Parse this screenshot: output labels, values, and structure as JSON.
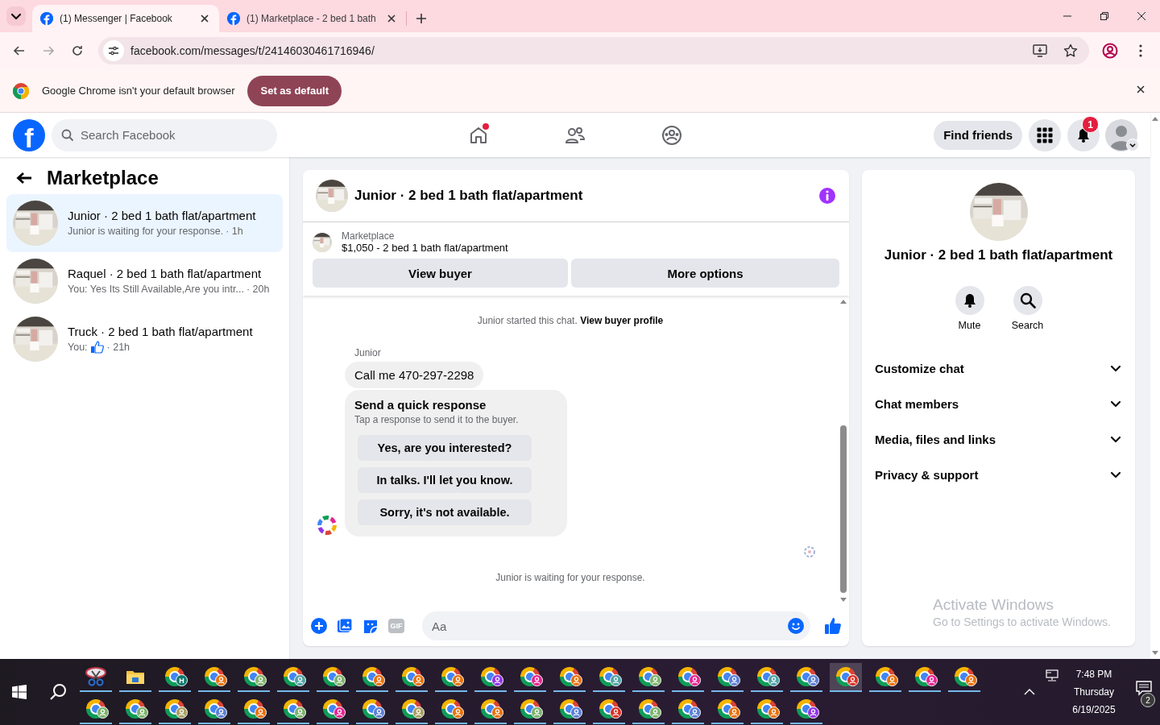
{
  "browser": {
    "tabs": [
      {
        "title": "(1) Messenger | Facebook",
        "selected": true
      },
      {
        "title": "(1) Marketplace - 2 bed 1 bath",
        "selected": false
      }
    ],
    "url": "facebook.com/messages/t/24146030461716946/"
  },
  "infobar": {
    "message": "Google Chrome isn't your default browser",
    "button": "Set as default"
  },
  "header": {
    "logo": "f",
    "search_placeholder": "Search Facebook",
    "nav": [
      {
        "kind": "home",
        "dot": true
      },
      {
        "kind": "friends",
        "dot": false
      },
      {
        "kind": "groups",
        "dot": false
      }
    ],
    "find_friends": "Find friends",
    "notification_count": "1"
  },
  "sidebar": {
    "title": "Marketplace",
    "conversations": [
      {
        "title": "Junior · 2 bed 1 bath flat/apartment",
        "kind": "text",
        "preview": "Junior is waiting for your response.",
        "time": "· 1h",
        "selected": true
      },
      {
        "title": "Raquel · 2 bed 1 bath flat/apartment",
        "kind": "text",
        "preview": "You: Yes Its Still Available,Are you intr...",
        "time": "· 20h",
        "selected": false
      },
      {
        "title": "Truck · 2 bed 1 bath flat/apartment",
        "kind": "like",
        "preview": "You:",
        "time": "· 21h",
        "selected": false
      }
    ]
  },
  "chat": {
    "title": "Junior · 2 bed 1 bath flat/apartment",
    "listing": {
      "label": "Marketplace",
      "detail": "$1,050 - 2 bed 1 bath flat/apartment"
    },
    "actions": [
      "View buyer",
      "More options"
    ],
    "system_note": {
      "text": "Junior started this chat.",
      "link": "View buyer profile"
    },
    "sender": "Junior",
    "message": "Call me 470-297-2298",
    "quick_response": {
      "title": "Send a quick response",
      "subtitle": "Tap a response to send it to the buyer.",
      "options": [
        "Yes, are you interested?",
        "In talks. I'll let you know.",
        "Sorry, it's not available."
      ]
    },
    "status": "Junior is waiting for your response.",
    "composer": {
      "gif": "GIF",
      "placeholder": "Aa"
    }
  },
  "details": {
    "title": "Junior · 2 bed 1 bath flat/apartment",
    "actions": [
      {
        "kind": "mute",
        "label": "Mute"
      },
      {
        "kind": "search",
        "label": "Search"
      }
    ],
    "sections": [
      {
        "label": "Customize chat",
        "expanded": false
      },
      {
        "label": "Chat members",
        "expanded": false
      },
      {
        "label": "Media, files and links",
        "expanded": false
      },
      {
        "label": "Privacy & support",
        "expanded": false
      }
    ]
  },
  "activation_notice": {
    "title": "Activate Windows",
    "subtitle": "Go to Settings to activate Windows."
  },
  "taskbar": {
    "row_1": [
      {
        "kind": "snipping",
        "selected": false
      },
      {
        "kind": "explorer",
        "selected": false
      },
      {
        "kind": "chrome",
        "badge": "H",
        "color": "#0f7a6c",
        "selected": false
      },
      {
        "kind": "chrome",
        "color": "#e8710a",
        "selected": false
      },
      {
        "kind": "chrome",
        "color": "#7cb36b",
        "selected": false
      },
      {
        "kind": "chrome",
        "color": "#4fa3a5",
        "selected": false
      },
      {
        "kind": "chrome",
        "color": "#7cb36b",
        "selected": false
      },
      {
        "kind": "chrome",
        "color": "#e8710a",
        "selected": false
      },
      {
        "kind": "chrome",
        "color": "#e8710a",
        "selected": false
      },
      {
        "kind": "chrome",
        "color": "#e8710a",
        "selected": false
      },
      {
        "kind": "chrome",
        "color": "#9334e6",
        "selected": false
      },
      {
        "kind": "chrome",
        "color": "#e52592",
        "selected": false
      },
      {
        "kind": "chrome",
        "color": "#e8710a",
        "selected": false
      },
      {
        "kind": "chrome",
        "color": "#4fa3a5",
        "selected": false
      },
      {
        "kind": "chrome",
        "color": "#7cb36b",
        "selected": false
      },
      {
        "kind": "chrome",
        "color": "#e52592",
        "selected": false
      },
      {
        "kind": "chrome",
        "color": "#5b7fd6",
        "selected": false
      },
      {
        "kind": "chrome",
        "color": "#4fa3a5",
        "selected": false
      },
      {
        "kind": "chrome",
        "color": "#5b7fd6",
        "selected": false
      },
      {
        "kind": "chrome",
        "color": "#d93025",
        "selected": true
      },
      {
        "kind": "chrome",
        "color": "#e8710a",
        "selected": false
      },
      {
        "kind": "chrome",
        "color": "#e52592",
        "selected": false
      },
      {
        "kind": "chrome",
        "color": "#e8710a",
        "selected": false
      }
    ],
    "row_2": [
      {
        "kind": "chrome",
        "color": "#7cb36b",
        "selected": false
      },
      {
        "kind": "chrome",
        "color": "#7cb36b",
        "selected": false
      },
      {
        "kind": "chrome",
        "color": "#a8a060",
        "selected": false
      },
      {
        "kind": "chrome",
        "color": "#5b7fd6",
        "selected": false
      },
      {
        "kind": "chrome",
        "color": "#e8710a",
        "selected": false
      },
      {
        "kind": "chrome",
        "color": "#7cb36b",
        "selected": false
      },
      {
        "kind": "chrome",
        "color": "#e52592",
        "selected": false
      },
      {
        "kind": "chrome",
        "color": "#5b7fd6",
        "selected": false
      },
      {
        "kind": "chrome",
        "color": "#a8a060",
        "selected": false
      },
      {
        "kind": "chrome",
        "color": "#e8710a",
        "selected": false
      },
      {
        "kind": "chrome",
        "color": "#e8710a",
        "selected": false
      },
      {
        "kind": "chrome",
        "color": "#7cb36b",
        "selected": false
      },
      {
        "kind": "chrome",
        "color": "#5b7fd6",
        "selected": false
      },
      {
        "kind": "chrome",
        "color": "#d93025",
        "selected": false
      },
      {
        "kind": "chrome",
        "color": "#7cb36b",
        "selected": false
      },
      {
        "kind": "chrome",
        "color": "#5b7fd6",
        "selected": false
      },
      {
        "kind": "chrome",
        "color": "#e8710a",
        "selected": false
      },
      {
        "kind": "chrome",
        "color": "#e8710a",
        "selected": false
      },
      {
        "kind": "chrome",
        "color": "#9334e6",
        "selected": false
      }
    ],
    "tray": {
      "time": "7:48 PM",
      "day": "Thursday",
      "date": "6/19/2025",
      "notifications": "2"
    }
  }
}
